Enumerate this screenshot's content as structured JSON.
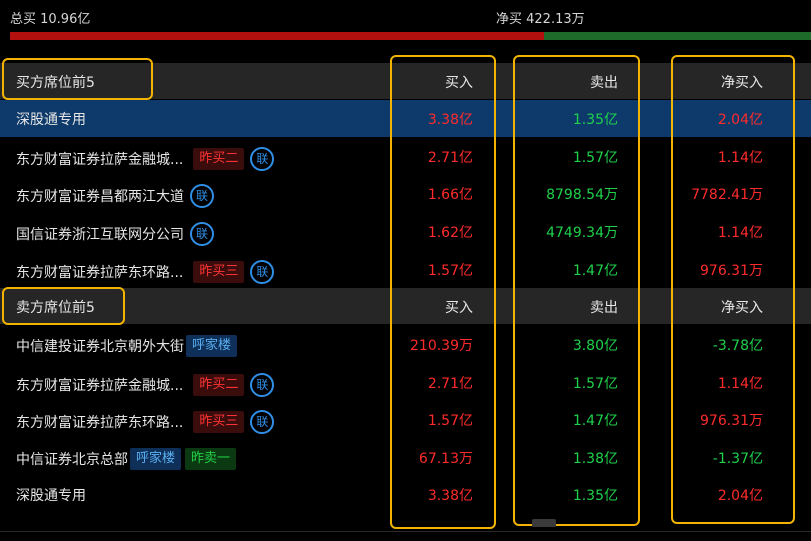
{
  "summary": {
    "total_buy": "总买 10.96亿",
    "net_buy": "净买 422.13万"
  },
  "colors": {
    "buy_bar": "#b20f0f",
    "sell_bar": "#1e6a2a",
    "highlight": "#f2b400",
    "selected_row": "#0d3a6a"
  },
  "buyers": {
    "title": "买方席位前5",
    "columns": [
      "买入",
      "卖出",
      "净买入"
    ],
    "rows": [
      {
        "name": "深股通专用",
        "buy": "3.38亿",
        "sell": "1.35亿",
        "net": "2.04亿"
      },
      {
        "name": "东方财富证券拉萨金融城...",
        "tag": "昨买二",
        "lian": "联",
        "buy": "2.71亿",
        "sell": "1.57亿",
        "net": "1.14亿"
      },
      {
        "name": "东方财富证券昌都两江大道",
        "lian": "联",
        "buy": "1.66亿",
        "sell": "8798.54万",
        "net": "7782.41万"
      },
      {
        "name": "国信证券浙江互联网分公司",
        "lian": "联",
        "buy": "1.62亿",
        "sell": "4749.34万",
        "net": "1.14亿"
      },
      {
        "name": "东方财富证券拉萨东环路...",
        "tag": "昨买三",
        "lian": "联",
        "buy": "1.57亿",
        "sell": "1.47亿",
        "net": "976.31万"
      }
    ]
  },
  "sellers": {
    "title": "卖方席位前5",
    "columns": [
      "买入",
      "卖出",
      "净买入"
    ],
    "rows": [
      {
        "name": "中信建投证券北京朝外大街",
        "tag_blue": "呼家楼",
        "buy": "210.39万",
        "sell": "3.80亿",
        "net": "-3.78亿"
      },
      {
        "name": "东方财富证券拉萨金融城...",
        "tag": "昨买二",
        "lian": "联",
        "buy": "2.71亿",
        "sell": "1.57亿",
        "net": "1.14亿"
      },
      {
        "name": "东方财富证券拉萨东环路...",
        "tag": "昨买三",
        "lian": "联",
        "buy": "1.57亿",
        "sell": "1.47亿",
        "net": "976.31万"
      },
      {
        "name": "中信证券北京总部",
        "tag_blue": "呼家楼",
        "tag_green": "昨卖一",
        "buy": "67.13万",
        "sell": "1.38亿",
        "net": "-1.37亿"
      },
      {
        "name": "深股通专用",
        "buy": "3.38亿",
        "sell": "1.35亿",
        "net": "2.04亿"
      }
    ]
  }
}
